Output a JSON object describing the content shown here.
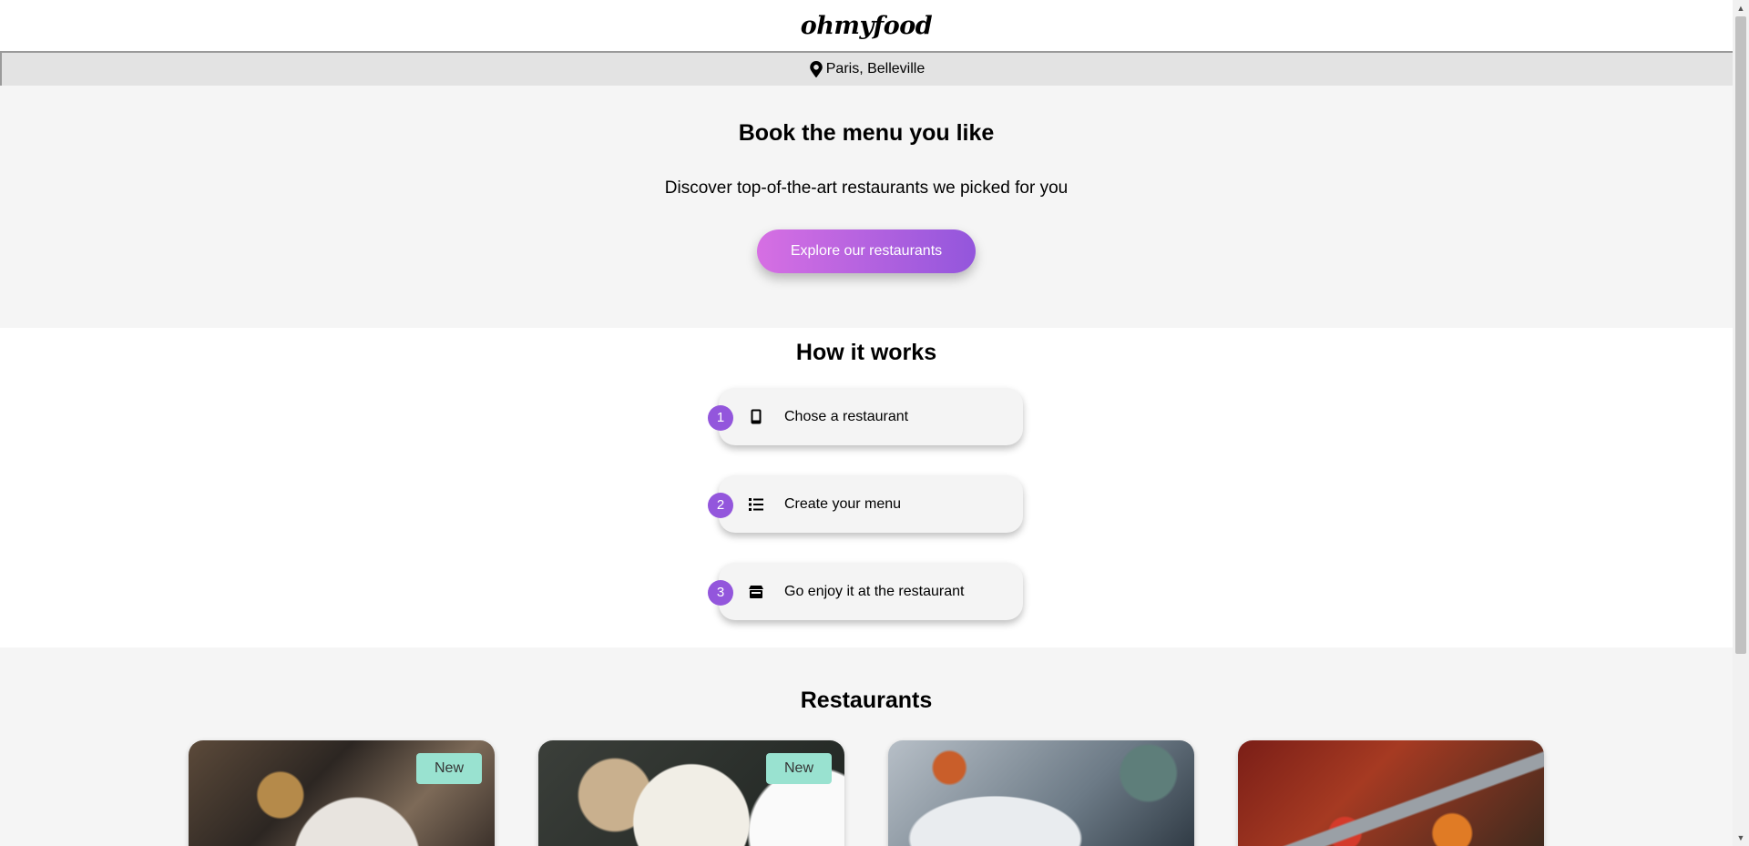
{
  "header": {
    "logo": "ohmyfood"
  },
  "location": {
    "icon": "map-pin-icon",
    "text": "Paris, Belleville"
  },
  "hero": {
    "title": "Book the menu you like",
    "subtitle": "Discover top-of-the-art restaurants we picked for you",
    "cta_label": "Explore our restaurants",
    "cta_gradient": [
      "#d66fe3",
      "#9356dc"
    ]
  },
  "how": {
    "title": "How it works",
    "accent": "#9356dc",
    "steps": [
      {
        "number": "1",
        "icon": "mobile-phone-icon",
        "label": "Chose a restaurant"
      },
      {
        "number": "2",
        "icon": "list-icon",
        "label": "Create your menu"
      },
      {
        "number": "3",
        "icon": "store-icon",
        "label": "Go enjoy it at the restaurant"
      }
    ]
  },
  "restaurants": {
    "title": "Restaurants",
    "badge_color": "#99e2d0",
    "cards": [
      {
        "badge": "New"
      },
      {
        "badge": "New"
      },
      {
        "badge": ""
      },
      {
        "badge": ""
      }
    ]
  }
}
